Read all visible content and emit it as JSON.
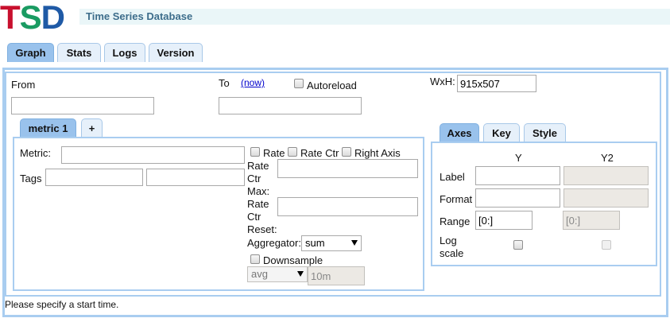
{
  "header": {
    "logo_t": "T",
    "logo_s": "S",
    "logo_d": "D",
    "title": "Time Series Database"
  },
  "tabs": [
    {
      "label": "Graph",
      "active": true
    },
    {
      "label": "Stats",
      "active": false
    },
    {
      "label": "Logs",
      "active": false
    },
    {
      "label": "Version",
      "active": false
    }
  ],
  "graph": {
    "from_label": "From",
    "from_value": "",
    "to_label": "To",
    "now_link": "(now)",
    "to_value": "",
    "autoreload_label": "Autoreload",
    "wxh_label": "WxH:",
    "wxh_value": "915x507"
  },
  "metric_tabs": [
    {
      "label": "metric 1",
      "active": true
    },
    {
      "label": "+",
      "active": false
    }
  ],
  "metric": {
    "metric_label": "Metric:",
    "metric_value": "",
    "rate_label": "Rate",
    "rate_ctr_label": "Rate Ctr",
    "right_axis_label": "Right Axis",
    "tags_label": "Tags",
    "tag_key": "",
    "tag_value": "",
    "rate_ctr_max_label_1": "Rate",
    "rate_ctr_max_label_2": "Ctr",
    "rate_ctr_max_label_3": "Max:",
    "rate_ctr_max_value": "",
    "rate_ctr_reset_label_1": "Rate",
    "rate_ctr_reset_label_2": "Ctr",
    "rate_ctr_reset_label_3": "Reset:",
    "rate_ctr_reset_value": "",
    "aggregator_label": "Aggregator:",
    "aggregator_value": "sum",
    "downsample_label": "Downsample",
    "downsample_func": "avg",
    "downsample_interval": "10m"
  },
  "options_tabs": [
    {
      "label": "Axes",
      "active": true
    },
    {
      "label": "Key",
      "active": false
    },
    {
      "label": "Style",
      "active": false
    }
  ],
  "axes": {
    "y_header": "Y",
    "y2_header": "Y2",
    "label_row": "Label",
    "format_row": "Format",
    "range_row": "Range",
    "log_row_1": "Log",
    "log_row_2": "scale",
    "y_label_value": "",
    "y2_label_value": "",
    "y_format_value": "",
    "y2_format_value": "",
    "y_range_value": "[0:]",
    "y2_range_value": "[0:]"
  },
  "status": {
    "message": "Please specify a start time."
  }
}
